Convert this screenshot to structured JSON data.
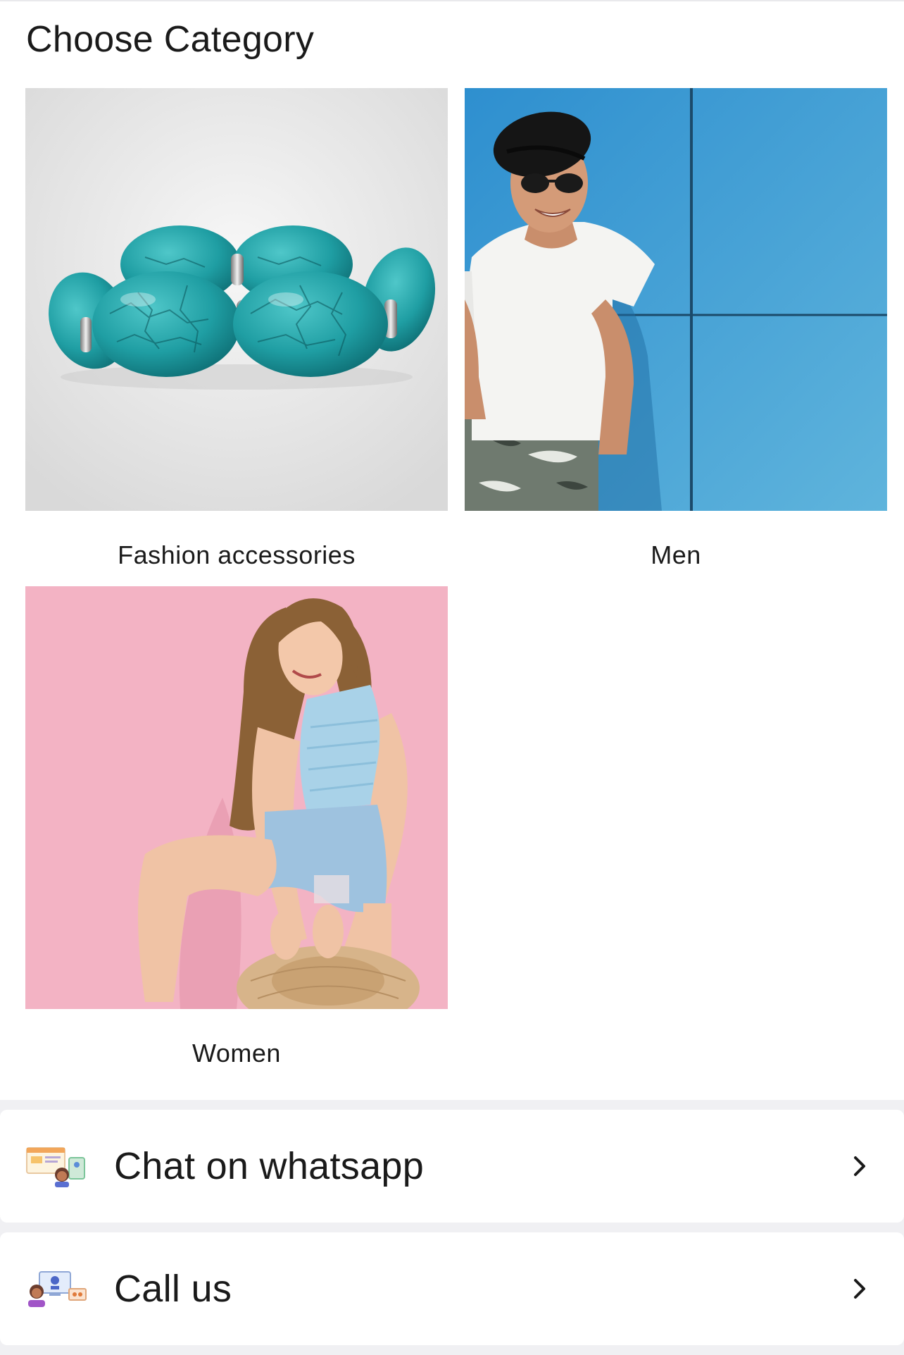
{
  "header": {
    "title": "Choose Category"
  },
  "categories": [
    {
      "label": "Fashion accessories",
      "image": "turquoise-bracelet-photo"
    },
    {
      "label": "Men",
      "image": "man-in-hat-photo"
    },
    {
      "label": "Women",
      "image": "woman-in-denim-photo"
    }
  ],
  "actions": [
    {
      "label": "Chat on whatsapp",
      "icon": "chat-support-icon"
    },
    {
      "label": "Call us",
      "icon": "call-support-icon"
    }
  ],
  "colors": {
    "background": "#ffffff",
    "section_gap": "#f0f0f3",
    "men_backdrop": "#3a9fd3",
    "women_backdrop": "#f3b3c4",
    "accessories_backdrop": "#e6e6e6",
    "turquoise": "#1f9ea3"
  }
}
